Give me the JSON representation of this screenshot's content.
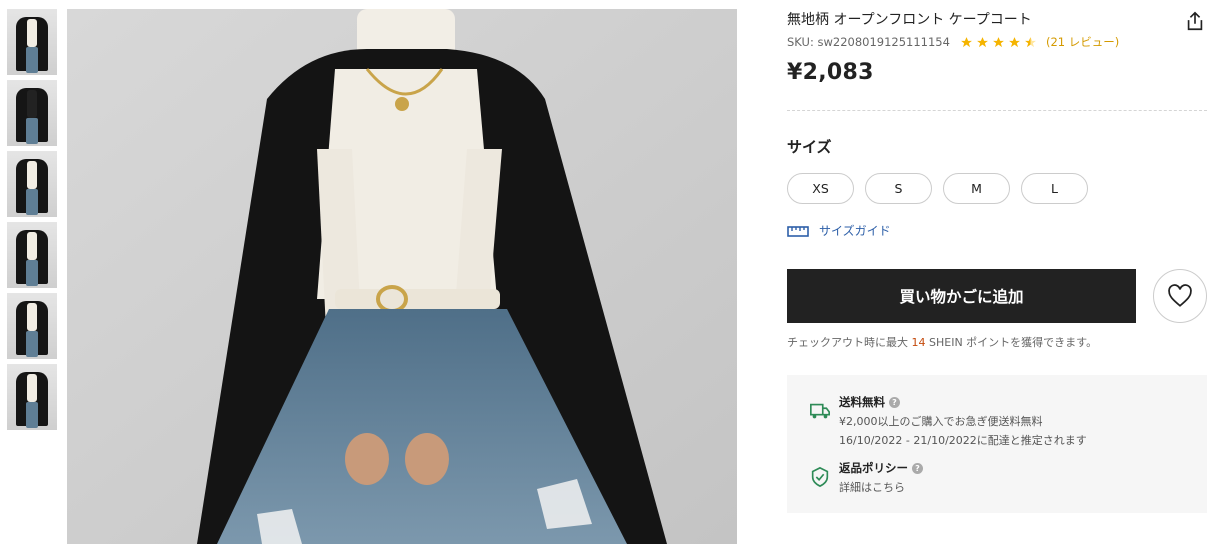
{
  "product": {
    "title": "無地柄 オープンフロント ケープコート",
    "sku": "SKU: sw2208019125111154",
    "rating": 4.5,
    "reviews": "(21 レビュー)",
    "price": "¥2,083"
  },
  "size_section": {
    "heading": "サイズ",
    "options": [
      "XS",
      "S",
      "M",
      "L"
    ],
    "guide_label": "サイズガイド"
  },
  "actions": {
    "add_to_cart": "買い物かごに追加",
    "points_prefix": "チェックアウト時に最大",
    "points_value": "14",
    "points_suffix": "SHEIN ポイントを獲得できます。"
  },
  "shipping": {
    "title": "送料無料",
    "line1": "¥2,000以上のご購入でお急ぎ便送料無料",
    "line2": "16/10/2022 - 21/10/2022に配達と推定されます"
  },
  "returns": {
    "title": "返品ポリシー",
    "link": "詳細はこちら"
  },
  "gallery": {
    "thumbnail_count": 6,
    "active_index": 2
  },
  "colors": {
    "accent_star": "#f5b400",
    "cart_button": "#222222",
    "link_blue": "#2d5fa8",
    "points_orange": "#c44a0c",
    "shipping_green": "#2e8b57"
  }
}
